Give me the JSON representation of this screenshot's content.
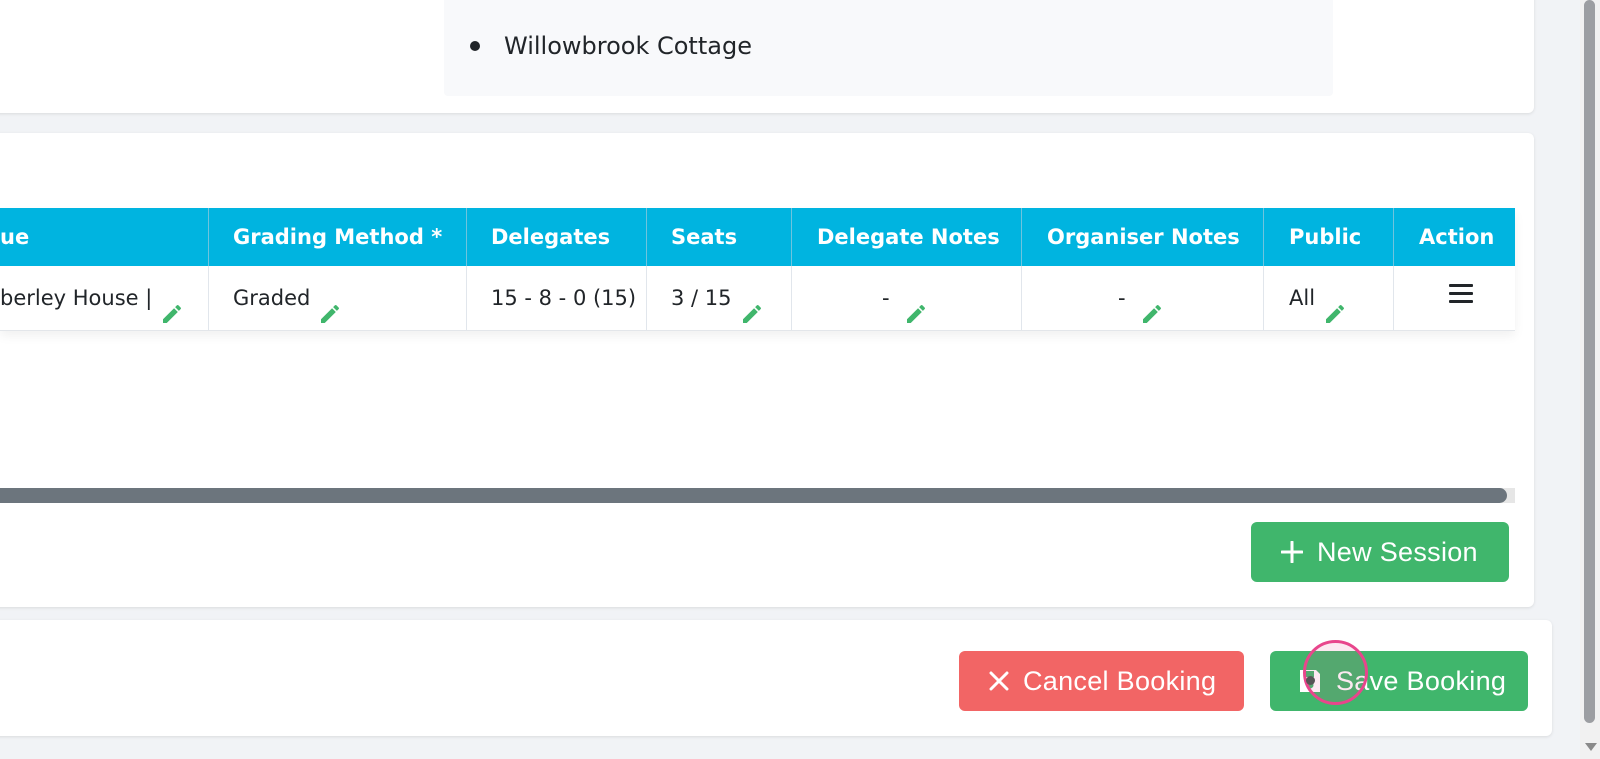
{
  "venue_list": {
    "items": [
      "Willowbrook Cottage"
    ]
  },
  "table": {
    "headers": {
      "venue": "ue",
      "grading_method": "Grading Method *",
      "delegates": "Delegates",
      "seats": "Seats",
      "delegate_notes": "Delegate Notes",
      "organiser_notes": "Organiser Notes",
      "public": "Public",
      "action": "Action"
    },
    "row": {
      "venue": "berley House |",
      "grading_method": "Graded",
      "delegates": "15 - 8 - 0 (15)",
      "seats": "3 / 15",
      "delegate_notes": "-",
      "organiser_notes": "-",
      "public": "All"
    }
  },
  "buttons": {
    "new_session": "New Session",
    "cancel_booking": "Cancel Booking",
    "save_booking": "Save Booking"
  },
  "icons": {
    "edit": "pencil-icon",
    "action_menu": "hamburger-menu-icon",
    "new_session": "plus-icon",
    "cancel": "close-icon",
    "save": "floppy-disk-icon"
  },
  "colors": {
    "table_header": "#00b4e0",
    "pencil": "#40b66c",
    "primary_green": "#40b66c",
    "danger_red": "#f26565"
  }
}
